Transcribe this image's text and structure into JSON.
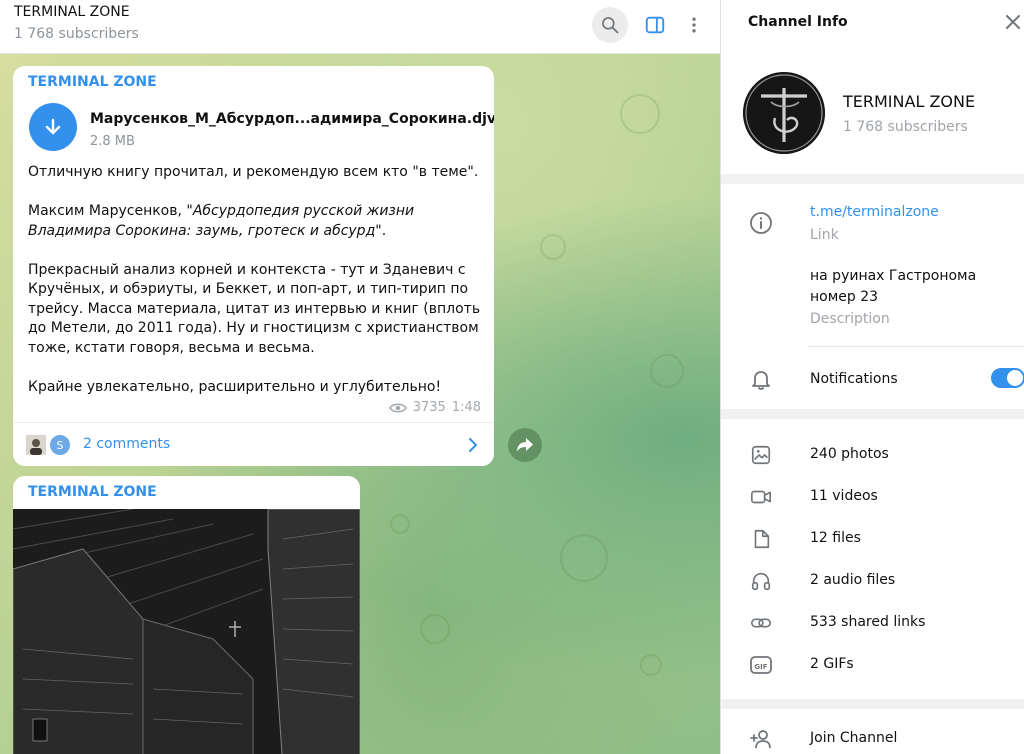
{
  "header": {
    "title": "TERMINAL ZONE",
    "subscribers": "1 768 subscribers",
    "icons": [
      "search-icon",
      "panel-toggle-icon",
      "more-vertical-icon"
    ]
  },
  "message1": {
    "sender": "TERMINAL ZONE",
    "file": {
      "name": "Марусенков_М_Абсурдоп...адимира_Сорокина.djvu",
      "size": "2.8 MB",
      "icon": "download-arrow-icon"
    },
    "paragraph1": "Отличную книгу прочитал, и рекомендую всем кто \"в теме\".",
    "paragraph2_prefix": "Максим Марусенков, ",
    "paragraph2_italic": "\"Абсурдопедия русской жизни Владимира Сорокина: заумь, гротеск и абсурд\"",
    "paragraph2_suffix": ".",
    "paragraph3": "Прекрасный анализ корней и контекста - тут и Зданевич с Кручёных, и обэриуты, и Беккет, и поп-арт, и тип-тирип по трейсу. Масса материала, цитат из интервью и книг (вплоть до Метели, до 2011 года). Ну и гностицизм с христианством тоже, кстати говоря, весьма и весьма.",
    "paragraph4": "Крайне увлекательно, расширительно и углубительно!",
    "views": "3735",
    "time": "1:48",
    "avatar2_letter": "S",
    "comments_label": "2 comments"
  },
  "message2": {
    "sender": "TERMINAL ZONE"
  },
  "info": {
    "title": "Channel Info",
    "channel_name": "TERMINAL ZONE",
    "channel_subs": "1 768 subscribers",
    "link": "t.me/terminalzone",
    "link_label": "Link",
    "description": "на руинах Гастронома номер 23",
    "description_label": "Description",
    "notifications_label": "Notifications",
    "notifications_on": true,
    "media": [
      {
        "label": "240 photos",
        "icon": "photo-icon"
      },
      {
        "label": "11 videos",
        "icon": "video-icon"
      },
      {
        "label": "12 files",
        "icon": "file-icon"
      },
      {
        "label": "2 audio files",
        "icon": "headphones-icon"
      },
      {
        "label": "533 shared links",
        "icon": "link-icon"
      },
      {
        "label": "2 GIFs",
        "icon": "gif-icon"
      }
    ],
    "join_label": "Join Channel",
    "accent": "#3390ec"
  }
}
